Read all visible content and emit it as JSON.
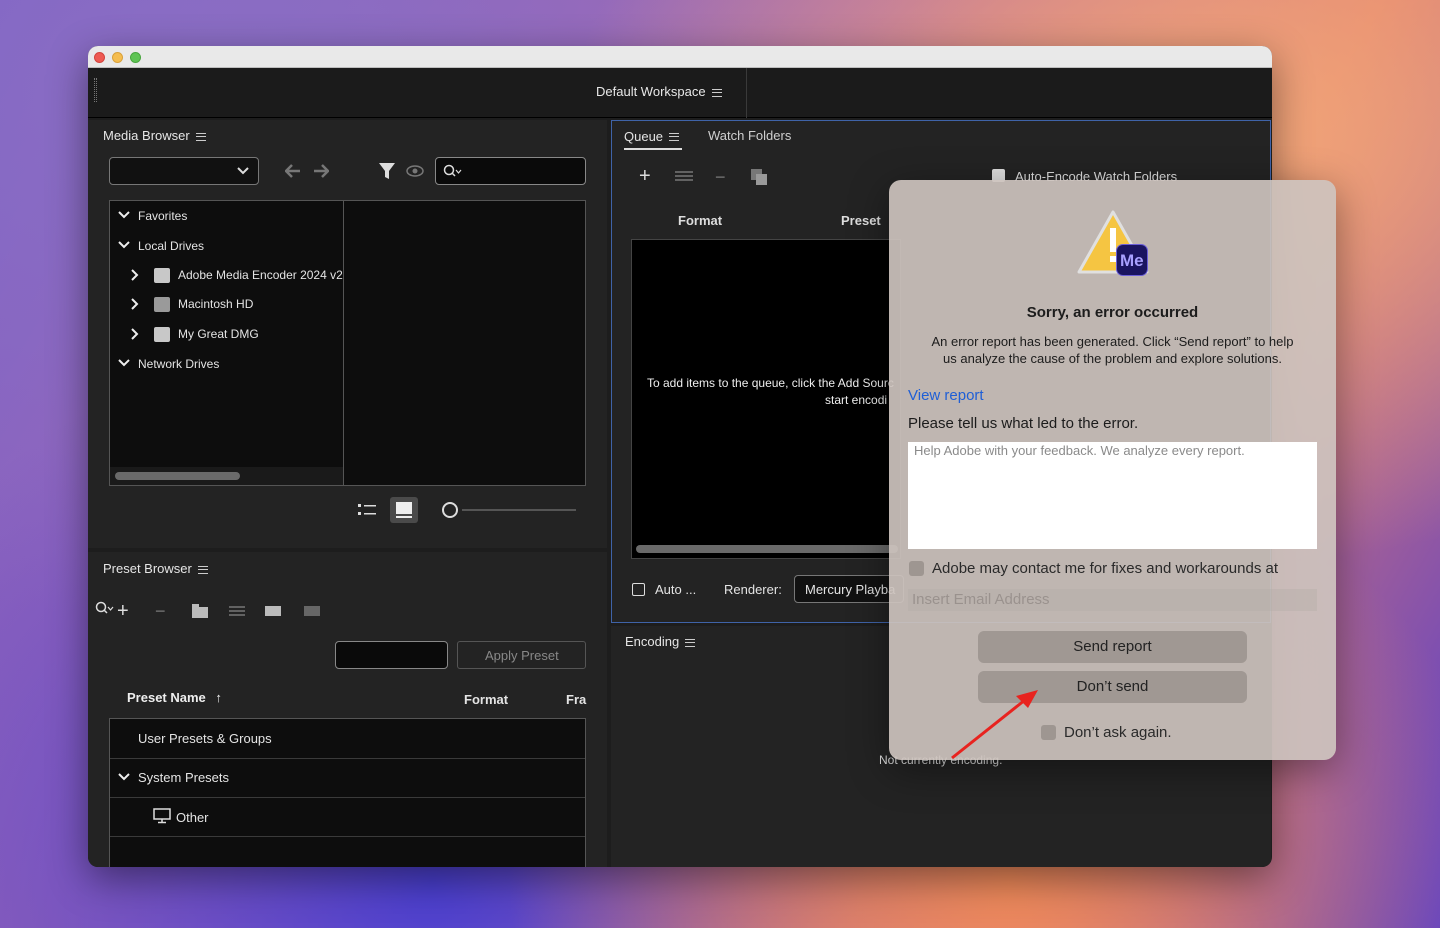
{
  "workspace": {
    "title": "Default Workspace"
  },
  "media_browser": {
    "title": "Media Browser",
    "tree": [
      {
        "label": "Favorites",
        "expanded": true,
        "level": 0
      },
      {
        "label": "Local Drives",
        "expanded": true,
        "level": 0
      },
      {
        "label": "Adobe Media Encoder 2024 v24",
        "level": 1
      },
      {
        "label": "Macintosh HD",
        "level": 1
      },
      {
        "label": "My Great DMG",
        "level": 1
      },
      {
        "label": "Network Drives",
        "expanded": true,
        "level": 0
      }
    ]
  },
  "preset_browser": {
    "title": "Preset Browser",
    "apply_label": "Apply Preset",
    "columns": {
      "name": "Preset Name",
      "format": "Format",
      "frame": "Fra"
    },
    "rows": [
      "User Presets & Groups",
      "System Presets",
      "Other"
    ]
  },
  "queue": {
    "tab_queue": "Queue",
    "tab_watch": "Watch Folders",
    "auto_encode_label": "Auto-Encode Watch Folders",
    "columns": {
      "format": "Format",
      "preset": "Preset"
    },
    "empty_line1": "To add items to the queue, click the Add Sourc",
    "empty_line2": "start encodi",
    "auto_label": "Auto ...",
    "renderer_label": "Renderer:",
    "renderer_value": "Mercury Playba"
  },
  "encoding": {
    "title": "Encoding",
    "status": "Not currently encoding."
  },
  "error_dialog": {
    "app_badge": "Me",
    "title": "Sorry, an error occurred",
    "message_line1": "An error report has been generated. Click “Send report” to help",
    "message_line2": "us analyze the cause of the problem and explore solutions.",
    "view_report": "View report",
    "prompt": "Please tell us what led to the error.",
    "feedback_placeholder": "Help Adobe with your feedback. We analyze every report.",
    "contact_label": "Adobe may contact me for fixes and workarounds at",
    "email_placeholder": "Insert Email Address",
    "send_label": "Send report",
    "dont_send_label": "Don’t send",
    "dont_ask_label": "Don’t ask again.",
    "colors": {
      "link": "#1f5fd6",
      "badge_bg": "#1a1460",
      "badge_text": "#a8a0ff",
      "warning": "#f5c542"
    }
  },
  "annotation": {
    "arrow_color": "#e8231f"
  }
}
